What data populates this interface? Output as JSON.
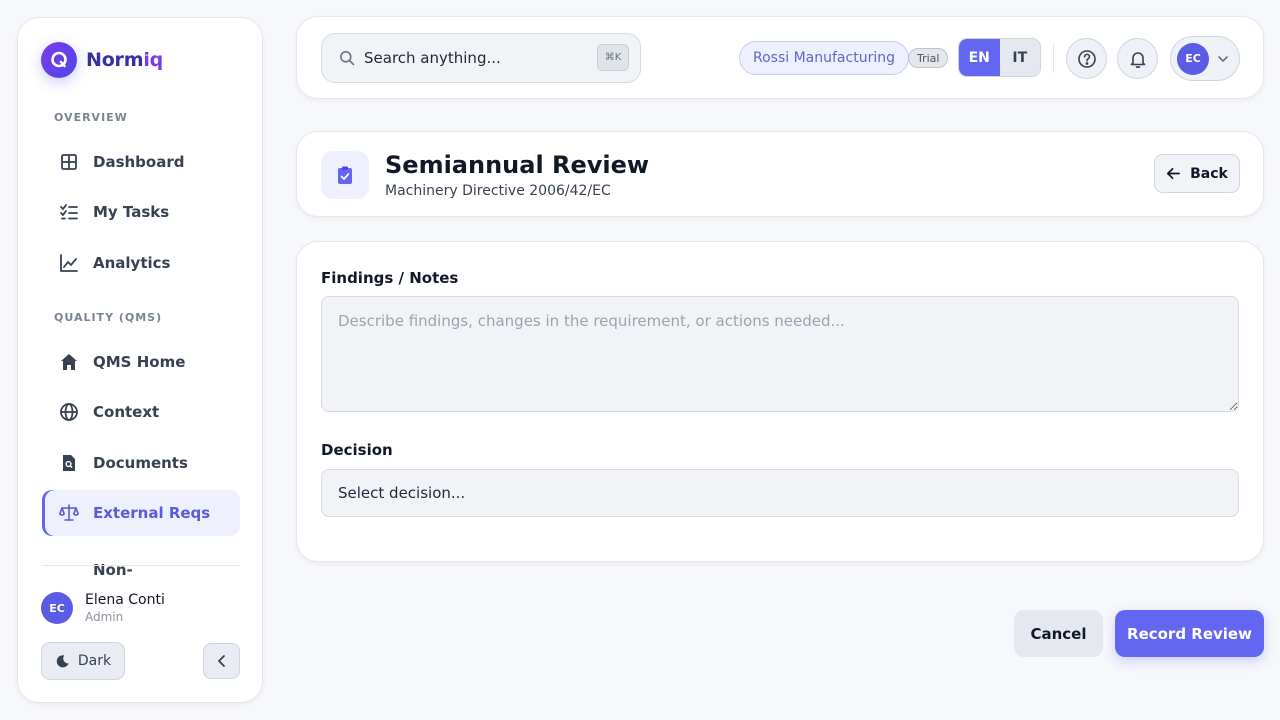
{
  "brand": {
    "name_part1": "Norm",
    "name_part2": "iq",
    "logo_letter": "Q"
  },
  "sidebar": {
    "sections": [
      {
        "label": "OVERVIEW"
      },
      {
        "label": "QUALITY (QMS)"
      }
    ],
    "items": [
      {
        "label": "Dashboard",
        "icon": "dashboard-grid-icon"
      },
      {
        "label": "My Tasks",
        "icon": "checklist-icon"
      },
      {
        "label": "Analytics",
        "icon": "line-chart-icon"
      },
      {
        "label": "QMS Home",
        "icon": "home-icon"
      },
      {
        "label": "Context",
        "icon": "globe-icon"
      },
      {
        "label": "Documents",
        "icon": "document-icon"
      },
      {
        "label": "External Reqs",
        "icon": "scale-icon",
        "active": true
      },
      {
        "label": "Non-",
        "icon": "none"
      }
    ],
    "user": {
      "initials": "EC",
      "name": "Elena Conti",
      "role": "Admin"
    },
    "theme_toggle_label": "Dark"
  },
  "header": {
    "search_placeholder": "Search anything...",
    "search_shortcut": "⌘K",
    "organization": "Rossi Manufacturing",
    "plan_badge": "Trial",
    "languages": [
      "EN",
      "IT"
    ],
    "active_language": "EN",
    "profile_initials": "EC"
  },
  "page": {
    "title": "Semiannual Review",
    "subtitle": "Machinery Directive 2006/42/EC",
    "back_label": "Back"
  },
  "form": {
    "notes_label": "Findings / Notes",
    "notes_placeholder": "Describe findings, changes in the requirement, or actions needed...",
    "notes_value": "",
    "decision_label": "Decision",
    "decision_value": "Select decision..."
  },
  "actions": {
    "cancel_label": "Cancel",
    "submit_label": "Record Review"
  },
  "colors": {
    "accent": "#6366f1",
    "active_bg": "#eef0fe",
    "text": "#111827"
  }
}
